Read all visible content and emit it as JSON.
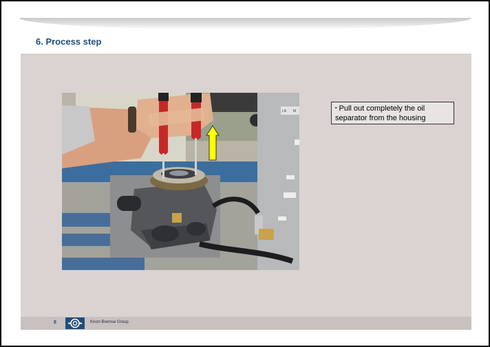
{
  "slide": {
    "title": "6. Process step",
    "page_number": "8",
    "company": "Knorr-Bremse Group"
  },
  "instruction": {
    "bullet": "▪",
    "text": "Pull out completely the oil separator from the housing"
  },
  "photo": {
    "placard_labels": [
      "I.A",
      "M"
    ]
  },
  "colors": {
    "title": "#1f4e79",
    "content_bg": "#dad3d1",
    "footer_bg": "#c9c1bf",
    "arrow": "#ffff00"
  },
  "icons": {
    "logo": "knorr-bremse-logo",
    "arrow": "up-arrow-icon"
  }
}
